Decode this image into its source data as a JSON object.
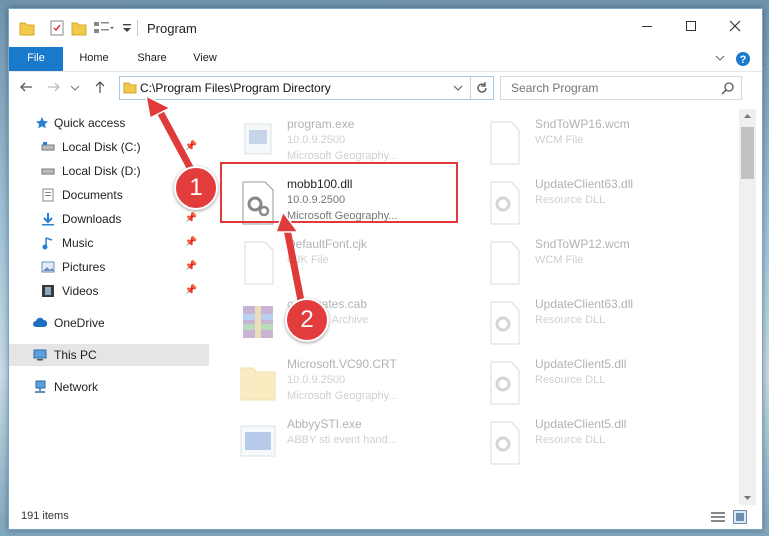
{
  "window": {
    "title": "Program"
  },
  "ribbon": {
    "tabs": [
      "File",
      "Home",
      "Share",
      "View"
    ]
  },
  "address": {
    "path": "C:\\Program Files\\Program Directory"
  },
  "search": {
    "placeholder": "Search Program"
  },
  "nav": {
    "items": [
      {
        "label": "Quick access"
      },
      {
        "label": "Local Disk (C:)"
      },
      {
        "label": "Local Disk (D:)"
      },
      {
        "label": "Documents"
      },
      {
        "label": "Downloads"
      },
      {
        "label": "Music"
      },
      {
        "label": "Pictures"
      },
      {
        "label": "Videos"
      },
      {
        "label": "OneDrive"
      },
      {
        "label": "This PC"
      },
      {
        "label": "Network"
      }
    ]
  },
  "files": {
    "col1": [
      {
        "name": "program.exe",
        "sub1": "10.0.9.2500",
        "sub2": "Microsoft Geography..."
      },
      {
        "name": "mobb100.dll",
        "sub1": "10.0.9.2500",
        "sub2": "Microsoft Geography..."
      },
      {
        "name": "DefaultFont.cjk",
        "sub1": "CJK File",
        "sub2": ""
      },
      {
        "name": "certificates.cab",
        "sub1": "WinRAR Archive",
        "sub2": ""
      },
      {
        "name": "Microsoft.VC90.CRT",
        "sub1": "10.0.9.2500",
        "sub2": "Microsoft Geography..."
      },
      {
        "name": "AbbyySTI.exe",
        "sub1": "ABBY sti event hand...",
        "sub2": ""
      }
    ],
    "col2": [
      {
        "name": "SndToWP16.wcm",
        "sub1": "WCM File"
      },
      {
        "name": "UpdateClient63.dll",
        "sub1": "Resource DLL"
      },
      {
        "name": "SndToWP12.wcm",
        "sub1": "WCM File"
      },
      {
        "name": "UpdateClient63.dll",
        "sub1": "Resource DLL"
      },
      {
        "name": "UpdateClient5.dll",
        "sub1": "Resource DLL"
      },
      {
        "name": "UpdateClient5.dll",
        "sub1": "Resource DLL"
      }
    ]
  },
  "status": {
    "count": "191 items"
  },
  "callouts": [
    "1",
    "2"
  ],
  "colors": {
    "accent": "#1979ca",
    "highlight": "#e03a3a"
  }
}
